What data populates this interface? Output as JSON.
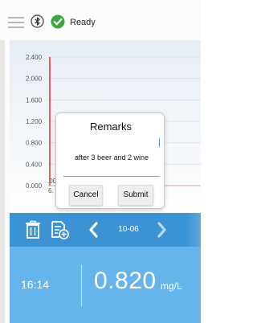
{
  "status": {
    "text": "Ready",
    "icons": [
      "menu-icon",
      "bluetooth-icon",
      "check-circle-icon"
    ]
  },
  "chart_data": {
    "type": "line",
    "yticks": [
      "2.400",
      "2.000",
      "1.600",
      "1.200",
      "0.800",
      "0.400",
      "0.000"
    ],
    "ylim": [
      0,
      2.4
    ],
    "xtick_partial": ".00",
    "xtick_partial_2": "6.",
    "series": [
      {
        "values": [
          0.0,
          2.4
        ]
      }
    ],
    "grid": true,
    "colors": {
      "line": "#e13a3a",
      "grid": "#d8dfe6",
      "plot_bg_top": "#e9eff5",
      "plot_bg_bottom": "#ffffff"
    }
  },
  "dialog": {
    "title": "Remarks",
    "input_value": "after 3 beer and 2 wine",
    "cancel_label": "Cancel",
    "submit_label": "Submit"
  },
  "toolbar": {
    "icons": [
      "trash-icon",
      "add-file-icon",
      "chevron-left-icon",
      "chevron-right-icon"
    ],
    "date": "10-06"
  },
  "reading": {
    "time": "16:14",
    "value": "0.820",
    "unit": "mg/L"
  },
  "colors": {
    "toolbar": "#3c93d3",
    "reading_bg": "#66b4ec",
    "accent": "#5bb8c4"
  }
}
